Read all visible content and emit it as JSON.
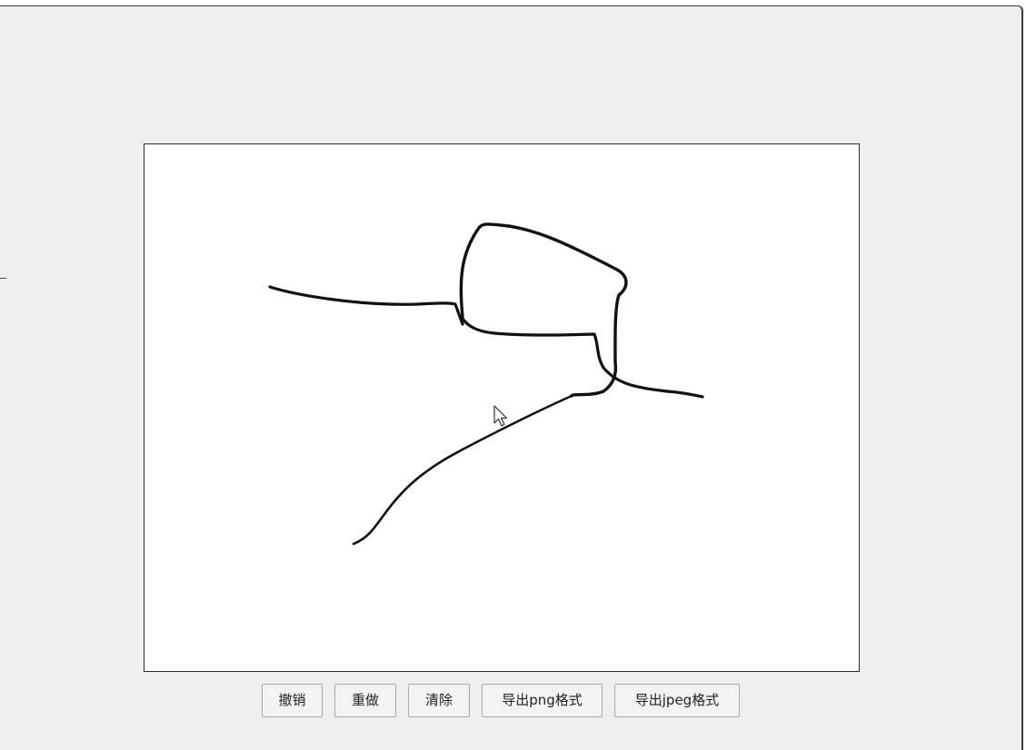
{
  "toolbar": {
    "undo_label": "撤销",
    "redo_label": "重做",
    "clear_label": "清除",
    "export_png_label": "导出png格式",
    "export_jpeg_label": "导出jpeg格式"
  },
  "canvas": {
    "background": "#ffffff",
    "stroke_color": "#111111"
  },
  "icons": {
    "cursor": "mouse-pointer-icon"
  }
}
